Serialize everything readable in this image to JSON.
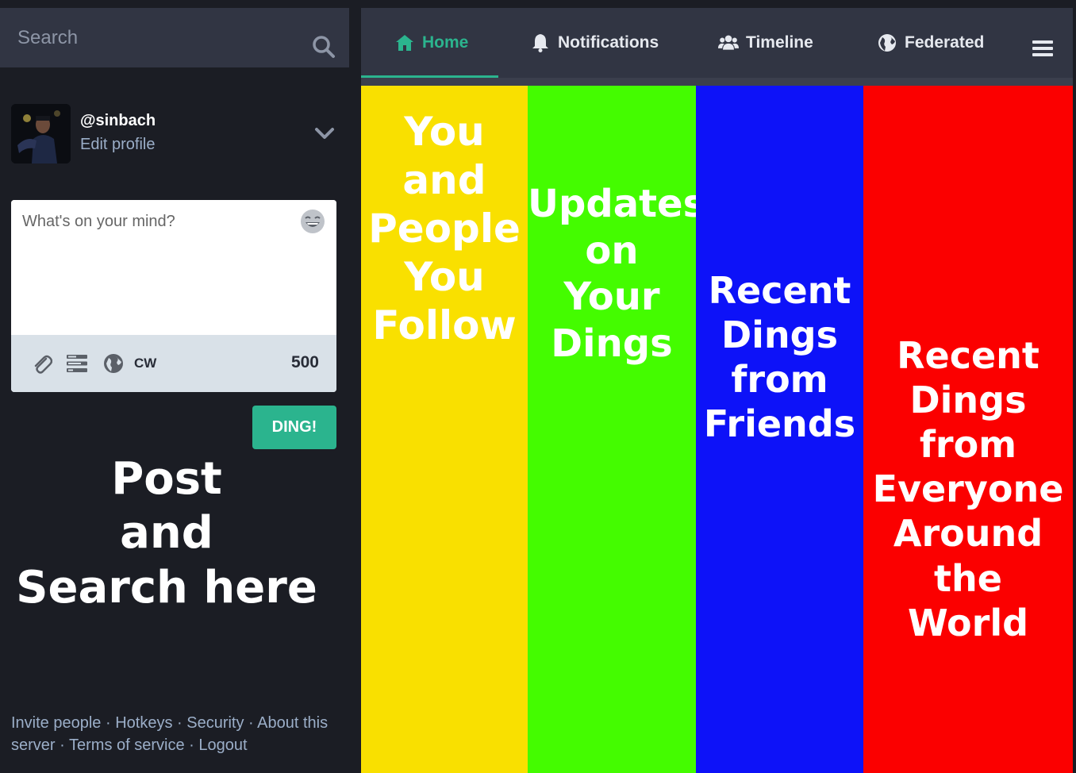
{
  "search": {
    "placeholder": "Search"
  },
  "profile": {
    "handle": "@sinbach",
    "edit_label": "Edit profile"
  },
  "compose": {
    "placeholder": "What's on your mind?",
    "cw_label": "CW",
    "char_count": "500",
    "submit_label": "DING!"
  },
  "left_overlay": {
    "lines": [
      "Post",
      "and",
      "Search here"
    ]
  },
  "footer": {
    "links": [
      "Invite people",
      "Hotkeys",
      "Security",
      "About this server",
      "Terms of service",
      "Logout"
    ],
    "separator": " · "
  },
  "nav": {
    "tabs": [
      {
        "label": "Home",
        "icon": "home-icon",
        "active": true
      },
      {
        "label": "Notifications",
        "icon": "bell-icon",
        "active": false
      },
      {
        "label": "Timeline",
        "icon": "users-icon",
        "active": false
      },
      {
        "label": "Federated",
        "icon": "globe-icon",
        "active": false
      }
    ],
    "menu_icon": "hamburger-menu-icon"
  },
  "columns": [
    {
      "color": "#f9e000",
      "lines": [
        "You",
        "and",
        "People",
        "You",
        "Follow"
      ]
    },
    {
      "color": "#44fc00",
      "lines": [
        "Updates",
        "on",
        "Your",
        "Dings"
      ]
    },
    {
      "color": "#0d12f8",
      "lines": [
        "Recent",
        "Dings",
        "from",
        "Friends"
      ]
    },
    {
      "color": "#fb0000",
      "lines": [
        "Recent",
        "Dings",
        "from",
        "Everyone",
        "Around",
        "the",
        "World"
      ]
    }
  ],
  "colors": {
    "accent": "#2bb48e",
    "panel": "#313543",
    "background": "#1b1d24"
  }
}
